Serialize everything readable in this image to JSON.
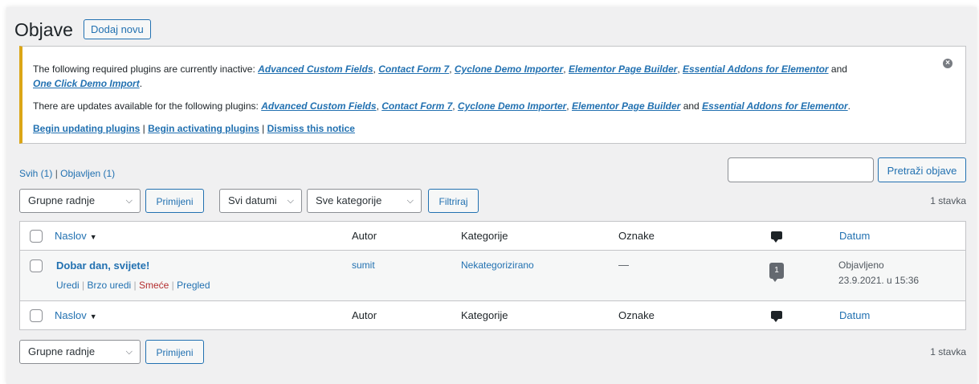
{
  "header": {
    "title": "Objave",
    "add_new": "Dodaj novu"
  },
  "notice": {
    "line1_prefix": "The following required plugins are currently inactive:",
    "inactive_plugins": [
      "Advanced Custom Fields",
      "Contact Form 7",
      "Cyclone Demo Importer",
      "Elementor Page Builder",
      "Essential Addons for Elementor",
      "One Click Demo Import"
    ],
    "and_word": "and",
    "line2_prefix": "There are updates available for the following plugins:",
    "update_plugins": [
      "Advanced Custom Fields",
      "Contact Form 7",
      "Cyclone Demo Importer",
      "Elementor Page Builder",
      "Essential Addons for Elementor"
    ],
    "actions": [
      "Begin updating plugins",
      "Begin activating plugins",
      "Dismiss this notice"
    ],
    "close_icon": "dismiss-icon"
  },
  "filters": {
    "all": "Svih (1)",
    "published": "Objavljen (1)",
    "search_button": "Pretraži objave",
    "search_value": "",
    "bulk_actions": "Grupne radnje",
    "apply": "Primijeni",
    "dates": "Svi datumi",
    "categories": "Sve kategorije",
    "filter": "Filtriraj",
    "count": "1 stavka"
  },
  "table": {
    "columns": {
      "title": "Naslov",
      "author": "Autor",
      "categories": "Kategorije",
      "tags": "Oznake",
      "date": "Datum"
    },
    "rows": [
      {
        "title": "Dobar dan, svijete!",
        "actions": {
          "edit": "Uredi",
          "quick_edit": "Brzo uredi",
          "trash": "Smeće",
          "view": "Pregled"
        },
        "author": "sumit",
        "category": "Nekategorizirano",
        "tags": "—",
        "comments": "1",
        "status": "Objavljeno",
        "date": "23.9.2021. u 15:36"
      }
    ]
  },
  "bottom": {
    "bulk_actions": "Grupne radnje",
    "apply": "Primijeni",
    "count": "1 stavka"
  }
}
